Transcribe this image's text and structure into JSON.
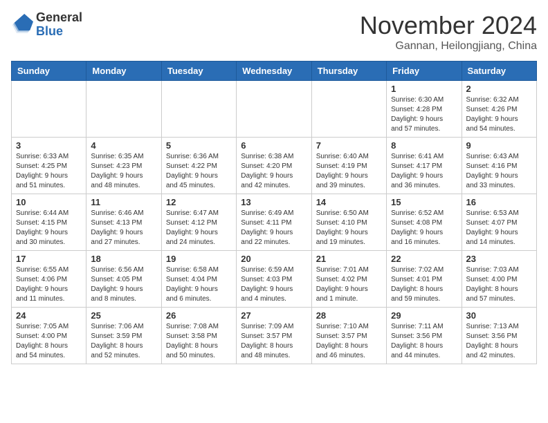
{
  "header": {
    "logo_general": "General",
    "logo_blue": "Blue",
    "month_title": "November 2024",
    "subtitle": "Gannan, Heilongjiang, China"
  },
  "calendar": {
    "days_of_week": [
      "Sunday",
      "Monday",
      "Tuesday",
      "Wednesday",
      "Thursday",
      "Friday",
      "Saturday"
    ],
    "weeks": [
      [
        {
          "day": "",
          "info": ""
        },
        {
          "day": "",
          "info": ""
        },
        {
          "day": "",
          "info": ""
        },
        {
          "day": "",
          "info": ""
        },
        {
          "day": "",
          "info": ""
        },
        {
          "day": "1",
          "info": "Sunrise: 6:30 AM\nSunset: 4:28 PM\nDaylight: 9 hours\nand 57 minutes."
        },
        {
          "day": "2",
          "info": "Sunrise: 6:32 AM\nSunset: 4:26 PM\nDaylight: 9 hours\nand 54 minutes."
        }
      ],
      [
        {
          "day": "3",
          "info": "Sunrise: 6:33 AM\nSunset: 4:25 PM\nDaylight: 9 hours\nand 51 minutes."
        },
        {
          "day": "4",
          "info": "Sunrise: 6:35 AM\nSunset: 4:23 PM\nDaylight: 9 hours\nand 48 minutes."
        },
        {
          "day": "5",
          "info": "Sunrise: 6:36 AM\nSunset: 4:22 PM\nDaylight: 9 hours\nand 45 minutes."
        },
        {
          "day": "6",
          "info": "Sunrise: 6:38 AM\nSunset: 4:20 PM\nDaylight: 9 hours\nand 42 minutes."
        },
        {
          "day": "7",
          "info": "Sunrise: 6:40 AM\nSunset: 4:19 PM\nDaylight: 9 hours\nand 39 minutes."
        },
        {
          "day": "8",
          "info": "Sunrise: 6:41 AM\nSunset: 4:17 PM\nDaylight: 9 hours\nand 36 minutes."
        },
        {
          "day": "9",
          "info": "Sunrise: 6:43 AM\nSunset: 4:16 PM\nDaylight: 9 hours\nand 33 minutes."
        }
      ],
      [
        {
          "day": "10",
          "info": "Sunrise: 6:44 AM\nSunset: 4:15 PM\nDaylight: 9 hours\nand 30 minutes."
        },
        {
          "day": "11",
          "info": "Sunrise: 6:46 AM\nSunset: 4:13 PM\nDaylight: 9 hours\nand 27 minutes."
        },
        {
          "day": "12",
          "info": "Sunrise: 6:47 AM\nSunset: 4:12 PM\nDaylight: 9 hours\nand 24 minutes."
        },
        {
          "day": "13",
          "info": "Sunrise: 6:49 AM\nSunset: 4:11 PM\nDaylight: 9 hours\nand 22 minutes."
        },
        {
          "day": "14",
          "info": "Sunrise: 6:50 AM\nSunset: 4:10 PM\nDaylight: 9 hours\nand 19 minutes."
        },
        {
          "day": "15",
          "info": "Sunrise: 6:52 AM\nSunset: 4:08 PM\nDaylight: 9 hours\nand 16 minutes."
        },
        {
          "day": "16",
          "info": "Sunrise: 6:53 AM\nSunset: 4:07 PM\nDaylight: 9 hours\nand 14 minutes."
        }
      ],
      [
        {
          "day": "17",
          "info": "Sunrise: 6:55 AM\nSunset: 4:06 PM\nDaylight: 9 hours\nand 11 minutes."
        },
        {
          "day": "18",
          "info": "Sunrise: 6:56 AM\nSunset: 4:05 PM\nDaylight: 9 hours\nand 8 minutes."
        },
        {
          "day": "19",
          "info": "Sunrise: 6:58 AM\nSunset: 4:04 PM\nDaylight: 9 hours\nand 6 minutes."
        },
        {
          "day": "20",
          "info": "Sunrise: 6:59 AM\nSunset: 4:03 PM\nDaylight: 9 hours\nand 4 minutes."
        },
        {
          "day": "21",
          "info": "Sunrise: 7:01 AM\nSunset: 4:02 PM\nDaylight: 9 hours\nand 1 minute."
        },
        {
          "day": "22",
          "info": "Sunrise: 7:02 AM\nSunset: 4:01 PM\nDaylight: 8 hours\nand 59 minutes."
        },
        {
          "day": "23",
          "info": "Sunrise: 7:03 AM\nSunset: 4:00 PM\nDaylight: 8 hours\nand 57 minutes."
        }
      ],
      [
        {
          "day": "24",
          "info": "Sunrise: 7:05 AM\nSunset: 4:00 PM\nDaylight: 8 hours\nand 54 minutes."
        },
        {
          "day": "25",
          "info": "Sunrise: 7:06 AM\nSunset: 3:59 PM\nDaylight: 8 hours\nand 52 minutes."
        },
        {
          "day": "26",
          "info": "Sunrise: 7:08 AM\nSunset: 3:58 PM\nDaylight: 8 hours\nand 50 minutes."
        },
        {
          "day": "27",
          "info": "Sunrise: 7:09 AM\nSunset: 3:57 PM\nDaylight: 8 hours\nand 48 minutes."
        },
        {
          "day": "28",
          "info": "Sunrise: 7:10 AM\nSunset: 3:57 PM\nDaylight: 8 hours\nand 46 minutes."
        },
        {
          "day": "29",
          "info": "Sunrise: 7:11 AM\nSunset: 3:56 PM\nDaylight: 8 hours\nand 44 minutes."
        },
        {
          "day": "30",
          "info": "Sunrise: 7:13 AM\nSunset: 3:56 PM\nDaylight: 8 hours\nand 42 minutes."
        }
      ]
    ]
  }
}
